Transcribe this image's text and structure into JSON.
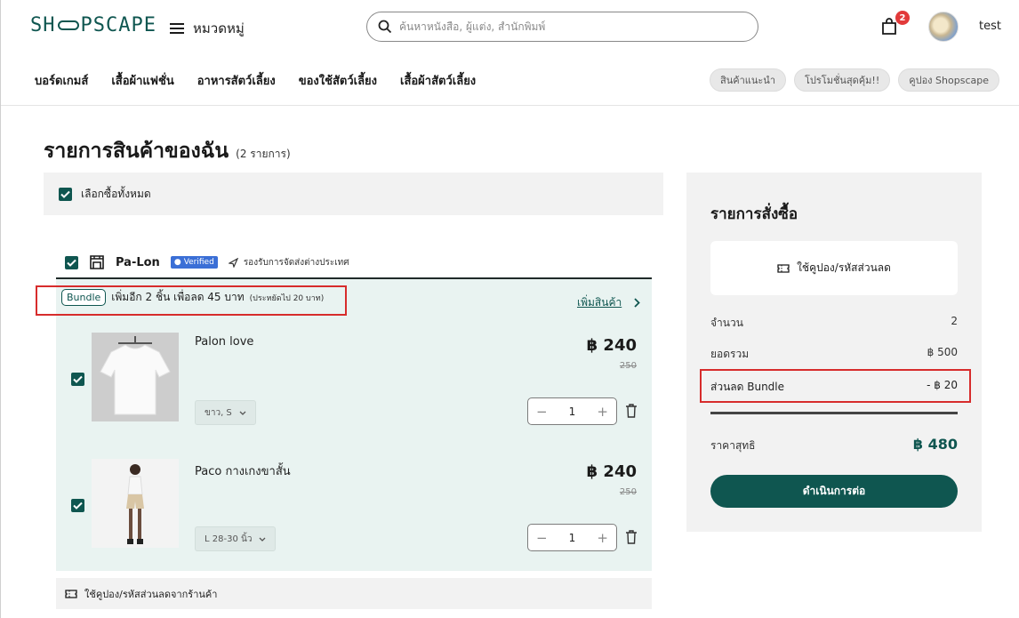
{
  "header": {
    "logo": "SH PSCAPE",
    "categories_label": "หมวดหมู่",
    "search_placeholder": "ค้นหาหนังสือ, ผู้แต่ง, สำนักพิมพ์",
    "cart_badge": "2",
    "username": "test"
  },
  "nav": {
    "items": [
      "บอร์ดเกมส์",
      "เสื้อผ้าแฟชั่น",
      "อาหารสัตว์เลี้ยง",
      "ของใช้สัตว์เลี้ยง",
      "เสื้อผ้าสัตว์เลี้ยง"
    ],
    "pills": [
      "สินค้าแนะนำ",
      "โปรโมชั่นสุดคุ้ม!!",
      "คูปอง Shopscape"
    ]
  },
  "page": {
    "title": "รายการสินค้าของฉัน",
    "count": "(2 รายการ)",
    "select_all": "เลือกซื้อทั้งหมด"
  },
  "store": {
    "name": "Pa-Lon",
    "verified": "Verified",
    "shipping": "รองรับการจัดส่งต่างประเทศ"
  },
  "bundle": {
    "tag": "Bundle",
    "text": "เพิ่มอีก 2 ชิ้น เพื่อลด 45 บาท",
    "note": "(ประหยัดไป 20 บาท)",
    "add_link": "เพิ่มสินค้า"
  },
  "items": [
    {
      "name": "Palon love",
      "price": "฿ 240",
      "old_price": "250",
      "variant": "ขาว, S",
      "qty": "1"
    },
    {
      "name": "Paco กางเกงขาสั้น",
      "price": "฿ 240",
      "old_price": "250",
      "variant": "L 28-30 นิ้ว",
      "qty": "1"
    }
  ],
  "shop_coupon": "ใช้คูปอง/รหัสส่วนลดจากร้านค้า",
  "summary": {
    "title": "รายการสั่งซื้อ",
    "coupon": "ใช้คูปอง/รหัสส่วนลด",
    "qty_label": "จำนวน",
    "qty_value": "2",
    "subtotal_label": "ยอดรวม",
    "subtotal_value": "฿ 500",
    "bundle_label": "ส่วนลด Bundle",
    "bundle_value": "- ฿ 20",
    "total_label": "ราคาสุทธิ",
    "total_value": "฿ 480",
    "checkout": "ดำเนินการต่อ"
  },
  "colors": {
    "brand": "#0f5650",
    "highlight": "#d72c2c",
    "badge": "#e23a3a"
  }
}
